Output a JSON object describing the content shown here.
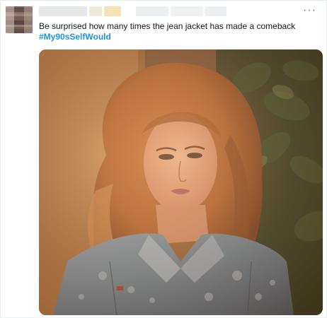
{
  "tweet": {
    "more_icon": "more-horizontal-icon",
    "text": "Be surprised how many times the jean jacket has made a comeback",
    "hashtag": "#My90sSelfWould",
    "photo_icon": "portrait-photo"
  },
  "colors": {
    "hashtag": "#1b95e0",
    "text": "#14171a",
    "border": "#e6ecf0"
  }
}
